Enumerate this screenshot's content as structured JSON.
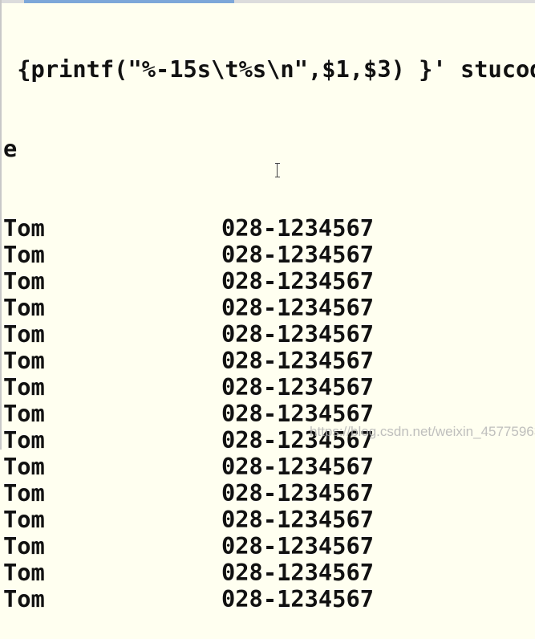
{
  "command_tail": " {printf(\"%-15s\\t%s\\n\",$1,$3) }' stucod",
  "command_wrap": "e",
  "rows": [
    {
      "name": "Tom",
      "phone": "028-1234567"
    },
    {
      "name": "Tom",
      "phone": "028-1234567"
    },
    {
      "name": "Tom",
      "phone": "028-1234567"
    },
    {
      "name": "Tom",
      "phone": "028-1234567"
    },
    {
      "name": "Tom",
      "phone": "028-1234567"
    },
    {
      "name": "Tom",
      "phone": "028-1234567"
    },
    {
      "name": "Tom",
      "phone": "028-1234567"
    },
    {
      "name": "Tom",
      "phone": "028-1234567"
    },
    {
      "name": "Tom",
      "phone": "028-1234567"
    },
    {
      "name": "Tom",
      "phone": "028-1234567"
    },
    {
      "name": "Tom",
      "phone": "028-1234567"
    },
    {
      "name": "Tom",
      "phone": "028-1234567"
    },
    {
      "name": "Tom",
      "phone": "028-1234567"
    },
    {
      "name": "Tom",
      "phone": "028-1234567"
    },
    {
      "name": "Tom",
      "phone": "028-1234567"
    }
  ],
  "watermark": "https://blog.csdn.net/weixin_45775963",
  "colors": {
    "background": "#fffff0",
    "text": "#111111"
  }
}
